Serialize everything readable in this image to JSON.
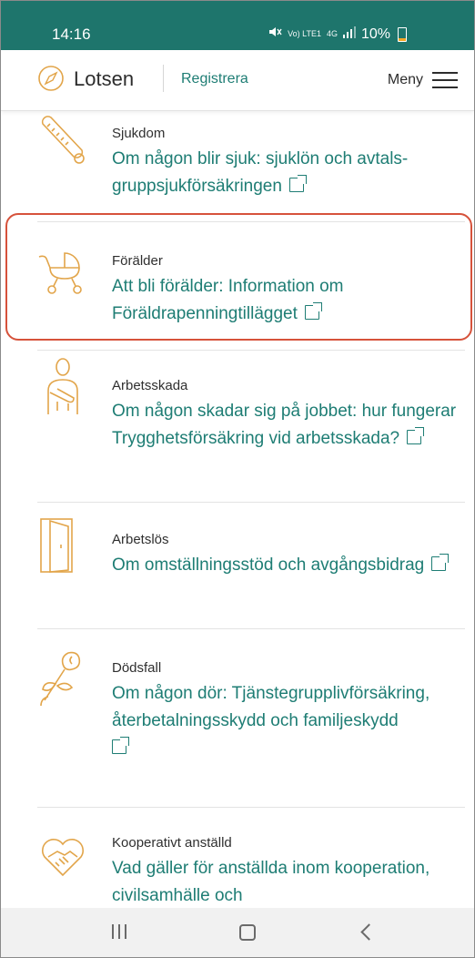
{
  "status_bar": {
    "time": "14:16",
    "network": "Vo) LTE1",
    "signal": "4G",
    "battery": "10%"
  },
  "header": {
    "brand": "Lotsen",
    "register_label": "Registrera",
    "menu_label": "Meny"
  },
  "items": [
    {
      "category": "Sjukdom",
      "link": "Om någon blir sjuk: sjuklön och avtals-gruppsjukförsäkringen",
      "icon": "thermometer-icon"
    },
    {
      "category": "Förälder",
      "link": "Att bli förälder: Information om Föräldrapenningtillägget",
      "icon": "stroller-icon"
    },
    {
      "category": "Arbetsskada",
      "link": "Om någon skadar sig på jobbet: hur fungerar Trygghetsförsäkring vid arbetsskada?",
      "icon": "injured-person-icon"
    },
    {
      "category": "Arbetslös",
      "link": "Om omställningsstöd och avgångsbidrag",
      "icon": "door-icon"
    },
    {
      "category": "Dödsfall",
      "link": "Om någon dör: Tjänstegrupplivförsäkring, återbetalningsskydd och familjeskydd",
      "icon": "rose-icon"
    },
    {
      "category": "Kooperativt anställd",
      "link": "Vad gäller för anställda inom kooperation, civilsamhälle och",
      "icon": "heart-hands-icon"
    }
  ],
  "colors": {
    "status_bar": "#1e756c",
    "link": "#1e7d74",
    "icon_accent": "#e2a54a",
    "highlight": "#d6523b"
  },
  "nav": {
    "recent": "recent-apps-icon",
    "home": "home-icon",
    "back": "back-icon"
  }
}
